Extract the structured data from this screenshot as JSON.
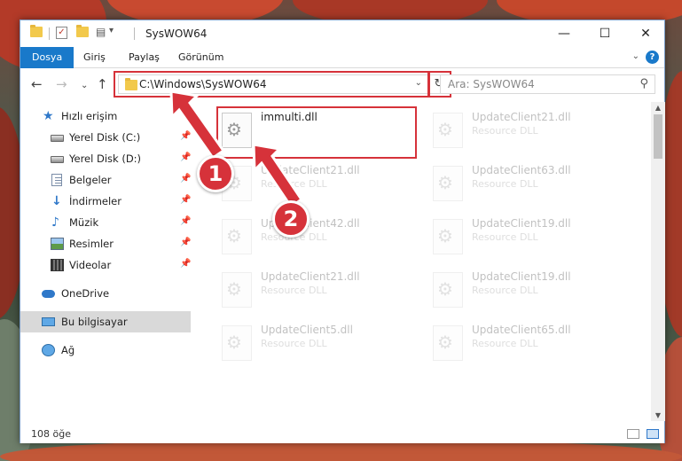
{
  "window": {
    "title": "SysWOW64",
    "qat_dropdown": "▾",
    "minimize": "—",
    "maximize": "☐",
    "close": "✕"
  },
  "ribbon": {
    "tabs": [
      "Dosya",
      "Giriş",
      "Paylaş",
      "Görünüm"
    ],
    "help": "?",
    "collapse": "⌄"
  },
  "nav": {
    "back": "←",
    "forward": "→",
    "recent": "⌄",
    "up": "↑"
  },
  "address": {
    "path": "C:\\Windows\\SysWOW64",
    "dropdown": "⌄",
    "refresh": "↻"
  },
  "search": {
    "placeholder": "Ara: SysWOW64",
    "icon": "⚲"
  },
  "sidebar": {
    "items": [
      {
        "label": "Hızlı erişim",
        "icon": "star-icon",
        "pinned": false
      },
      {
        "label": "Yerel Disk (C:)",
        "icon": "drive-icon",
        "pinned": true
      },
      {
        "label": "Yerel Disk (D:)",
        "icon": "drive-icon",
        "pinned": true
      },
      {
        "label": "Belgeler",
        "icon": "documents-icon",
        "pinned": true
      },
      {
        "label": "İndirmeler",
        "icon": "downloads-icon",
        "pinned": true
      },
      {
        "label": "Müzik",
        "icon": "music-icon",
        "pinned": true
      },
      {
        "label": "Resimler",
        "icon": "pictures-icon",
        "pinned": true
      },
      {
        "label": "Videolar",
        "icon": "videos-icon",
        "pinned": true
      },
      {
        "label": "OneDrive",
        "icon": "onedrive-icon",
        "pinned": false
      },
      {
        "label": "Bu bilgisayar",
        "icon": "this-pc-icon",
        "pinned": false,
        "selected": true
      },
      {
        "label": "Ağ",
        "icon": "network-icon",
        "pinned": false
      }
    ],
    "pin_glyph": "📌"
  },
  "files": [
    {
      "name": "immulti.dll",
      "type": ""
    },
    {
      "name": "UpdateClient21.dll",
      "type": "Resource DLL"
    },
    {
      "name": "UpdateClient21.dll",
      "type": "Resource DLL"
    },
    {
      "name": "UpdateClient63.dll",
      "type": "Resource DLL"
    },
    {
      "name": "UpdateClient42.dll",
      "type": "Resource DLL"
    },
    {
      "name": "UpdateClient19.dll",
      "type": "Resource DLL"
    },
    {
      "name": "UpdateClient21.dll",
      "type": "Resource DLL"
    },
    {
      "name": "UpdateClient19.dll",
      "type": "Resource DLL"
    },
    {
      "name": "UpdateClient5.dll",
      "type": "Resource DLL"
    },
    {
      "name": "UpdateClient65.dll",
      "type": "Resource DLL"
    }
  ],
  "status": {
    "item_count": "108 öğe"
  },
  "annotations": {
    "step1": "1",
    "step2": "2",
    "color": "#d6323a"
  },
  "colors": {
    "accent": "#1979ca",
    "highlight": "#d6323a"
  }
}
